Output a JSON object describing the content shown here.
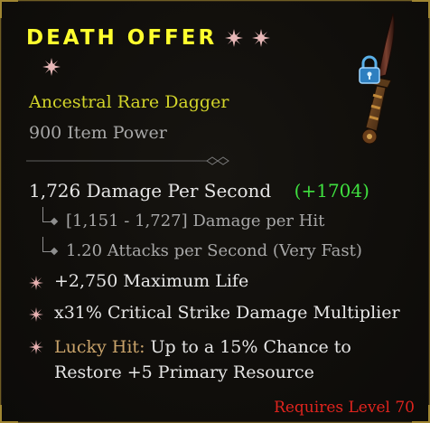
{
  "item": {
    "name": "DEATH OFFER",
    "type": "Ancestral Rare Dagger",
    "item_power": "900 Item Power",
    "sockets": 3,
    "locked": true
  },
  "damage": {
    "dps": "1,726 Damage Per Second",
    "dps_bonus": "(+1704)",
    "per_hit": "[1,151 - 1,727] Damage per Hit",
    "attack_speed": "1.20 Attacks per Second (Very Fast)"
  },
  "affixes": {
    "life": "+2,750 Maximum Life",
    "crit": "x31% Critical Strike Damage Multiplier",
    "lucky_label": "Lucky Hit:",
    "lucky_text": "Up to a 15% Chance to Restore +5 Primary Resource"
  },
  "requirement": "Requires Level 70",
  "colors": {
    "title": "#ffff2e",
    "rare": "#d2d42a",
    "bonus": "#3fe03f",
    "requirement": "#e0241e",
    "affix_star": "#e6b0b0"
  },
  "icons": {
    "socket": "empty-socket-icon",
    "lock": "padlock-icon",
    "affix": "affix-star-icon",
    "item_image": "dagger-icon"
  }
}
